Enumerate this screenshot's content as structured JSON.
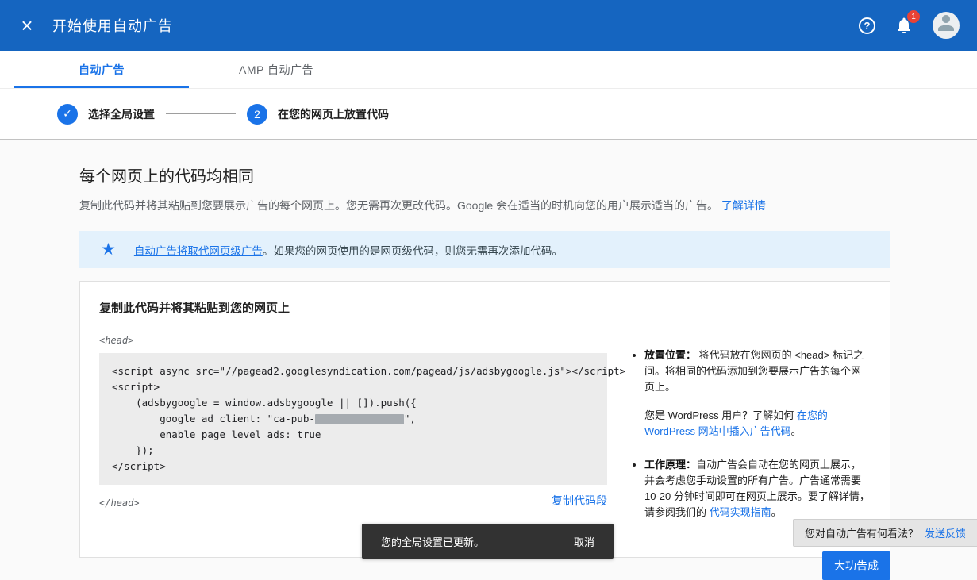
{
  "header": {
    "title": "开始使用自动广告",
    "notification_count": "1"
  },
  "tabs": [
    {
      "label": "自动广告"
    },
    {
      "label": "AMP 自动广告"
    }
  ],
  "stepper": {
    "step1_label": "选择全局设置",
    "step2_number": "2",
    "step2_label": "在您的网页上放置代码"
  },
  "main": {
    "heading": "每个网页上的代码均相同",
    "description": "复制此代码并将其粘贴到您要展示广告的每个网页上。您无需再次更改代码。Google 会在适当的时机向您的用户展示适当的广告。",
    "learn_more_link": "了解详情",
    "banner": {
      "link": "自动广告将取代网页级广告",
      "text": "。如果您的网页使用的是网页级代码，则您无需再次添加代码。"
    },
    "card": {
      "title": "复制此代码并将其粘贴到您的网页上",
      "head_open": "<head>",
      "head_close": "</head>",
      "code": {
        "line1": "<script async src=\"//pagead2.googlesyndication.com/pagead/js/adsbygoogle.js\"></script>",
        "line2": "<script>",
        "line3": "    (adsbygoogle = window.adsbygoogle || []).push({",
        "line4_prefix": "        google_ad_client: \"ca-pub-",
        "line4_suffix": "\",",
        "line5": "        enable_page_level_ads: true",
        "line6": "    });",
        "line7": "</script>"
      },
      "copy_link": "复制代码段",
      "bullets": {
        "placement": {
          "label": "放置位置：",
          "text": " 将代码放在您网页的 <head> 标记之间。将相同的代码添加到您要展示广告的每个网页上。",
          "wordpress_text": "您是 WordPress 用户？了解如何 ",
          "wordpress_link": "在您的 WordPress 网站中插入广告代码",
          "wordpress_after": "。"
        },
        "how_it_works": {
          "label": "工作原理：",
          "text": "自动广告会自动在您的网页上展示，并会考虑您手动设置的所有广告。广告通常需要 10-20 分钟时间即可在网页上展示。要了解详情，请参阅我们的 ",
          "link": "代码实现指南",
          "after": "。"
        }
      }
    }
  },
  "toast": {
    "message": "您的全局设置已更新。",
    "action": "取消"
  },
  "feedback": {
    "question": "您对自动广告有何看法？",
    "action": "发送反馈"
  },
  "done_button_label": "大功告成"
}
